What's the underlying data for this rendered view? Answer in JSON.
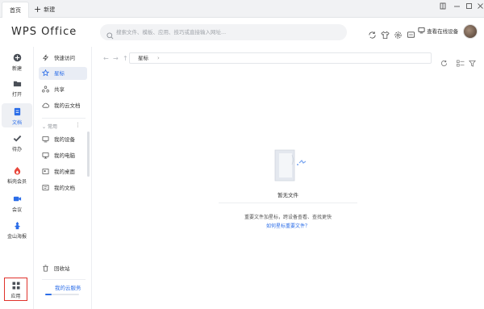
{
  "tabs": {
    "home": "首页",
    "new_tab": "新建"
  },
  "header": {
    "logo": "WPS Office",
    "search_placeholder": "搜索文件、模板、应用、技巧或直接输入网址...",
    "device_button": "查看在线设备"
  },
  "rail": {
    "items": [
      {
        "label": "新建",
        "icon": "plus-circle-icon"
      },
      {
        "label": "打开",
        "icon": "folder-icon"
      },
      {
        "label": "文档",
        "icon": "document-icon"
      },
      {
        "label": "待办",
        "icon": "check-icon"
      },
      {
        "label": "稻壳会员",
        "icon": "docer-icon"
      },
      {
        "label": "会议",
        "icon": "video-icon"
      },
      {
        "label": "金山海报",
        "icon": "poster-icon"
      },
      {
        "label": "应用",
        "icon": "apps-grid-icon"
      }
    ]
  },
  "nav": {
    "items": [
      {
        "label": "快速访问",
        "icon": "quick-access-icon"
      },
      {
        "label": "星标",
        "icon": "star-icon"
      },
      {
        "label": "共享",
        "icon": "share-icon"
      },
      {
        "label": "我的云文档",
        "icon": "cloud-icon"
      }
    ],
    "section_label": "常用",
    "common": [
      {
        "label": "我的设备",
        "icon": "device-icon"
      },
      {
        "label": "我的电脑",
        "icon": "computer-icon"
      },
      {
        "label": "我的桌面",
        "icon": "desktop-icon"
      },
      {
        "label": "我的文档",
        "icon": "documents-icon"
      }
    ],
    "recycle": "回收站",
    "cloud_service": "我的云服务"
  },
  "main": {
    "breadcrumb": "星标",
    "empty_title": "暂无文件",
    "empty_desc": "重要文件加星标，跨设备查看、查找更快",
    "empty_link": "如何星标重要文件？"
  },
  "colors": {
    "accent": "#2b6de8",
    "highlight_box": "#e0322b",
    "active_bg": "#e9edf5"
  }
}
